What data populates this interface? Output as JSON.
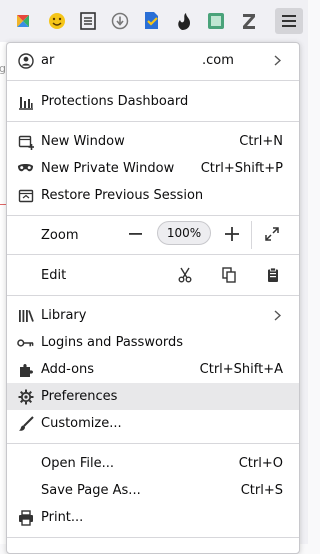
{
  "toolbar": {
    "extensions": [
      {
        "name": "site-extension-icon",
        "color": "#e8483c"
      },
      {
        "name": "emoji-extension-icon",
        "color": "#f5c518"
      },
      {
        "name": "reader-extension-icon",
        "color": "#333333"
      },
      {
        "name": "download-extension-icon",
        "color": "#777777"
      },
      {
        "name": "document-extension-icon",
        "color": "#2a6fd6"
      },
      {
        "name": "gnome-extension-icon",
        "color": "#222222"
      },
      {
        "name": "note-extension-icon",
        "color": "#4aa37a"
      },
      {
        "name": "z-extension-icon",
        "color": "#555555"
      }
    ],
    "menu_icon": "hamburger-menu-icon"
  },
  "menu": {
    "account": {
      "name": "ar",
      "domain": ".com"
    },
    "protections": "Protections Dashboard",
    "new_window": {
      "label": "New Window",
      "shortcut": "Ctrl+N"
    },
    "new_private": {
      "label": "New Private Window",
      "shortcut": "Ctrl+Shift+P"
    },
    "restore": "Restore Previous Session",
    "zoom": {
      "label": "Zoom",
      "value": "100%",
      "minus": "−",
      "plus": "+"
    },
    "edit": {
      "label": "Edit"
    },
    "library": "Library",
    "logins": "Logins and Passwords",
    "addons": {
      "label": "Add-ons",
      "shortcut": "Ctrl+Shift+A"
    },
    "preferences": "Preferences",
    "customize": "Customize...",
    "open_file": {
      "label": "Open File...",
      "shortcut": "Ctrl+O"
    },
    "save_page": {
      "label": "Save Page As...",
      "shortcut": "Ctrl+S"
    },
    "print": "Print..."
  },
  "page": {
    "fragment": "g"
  }
}
